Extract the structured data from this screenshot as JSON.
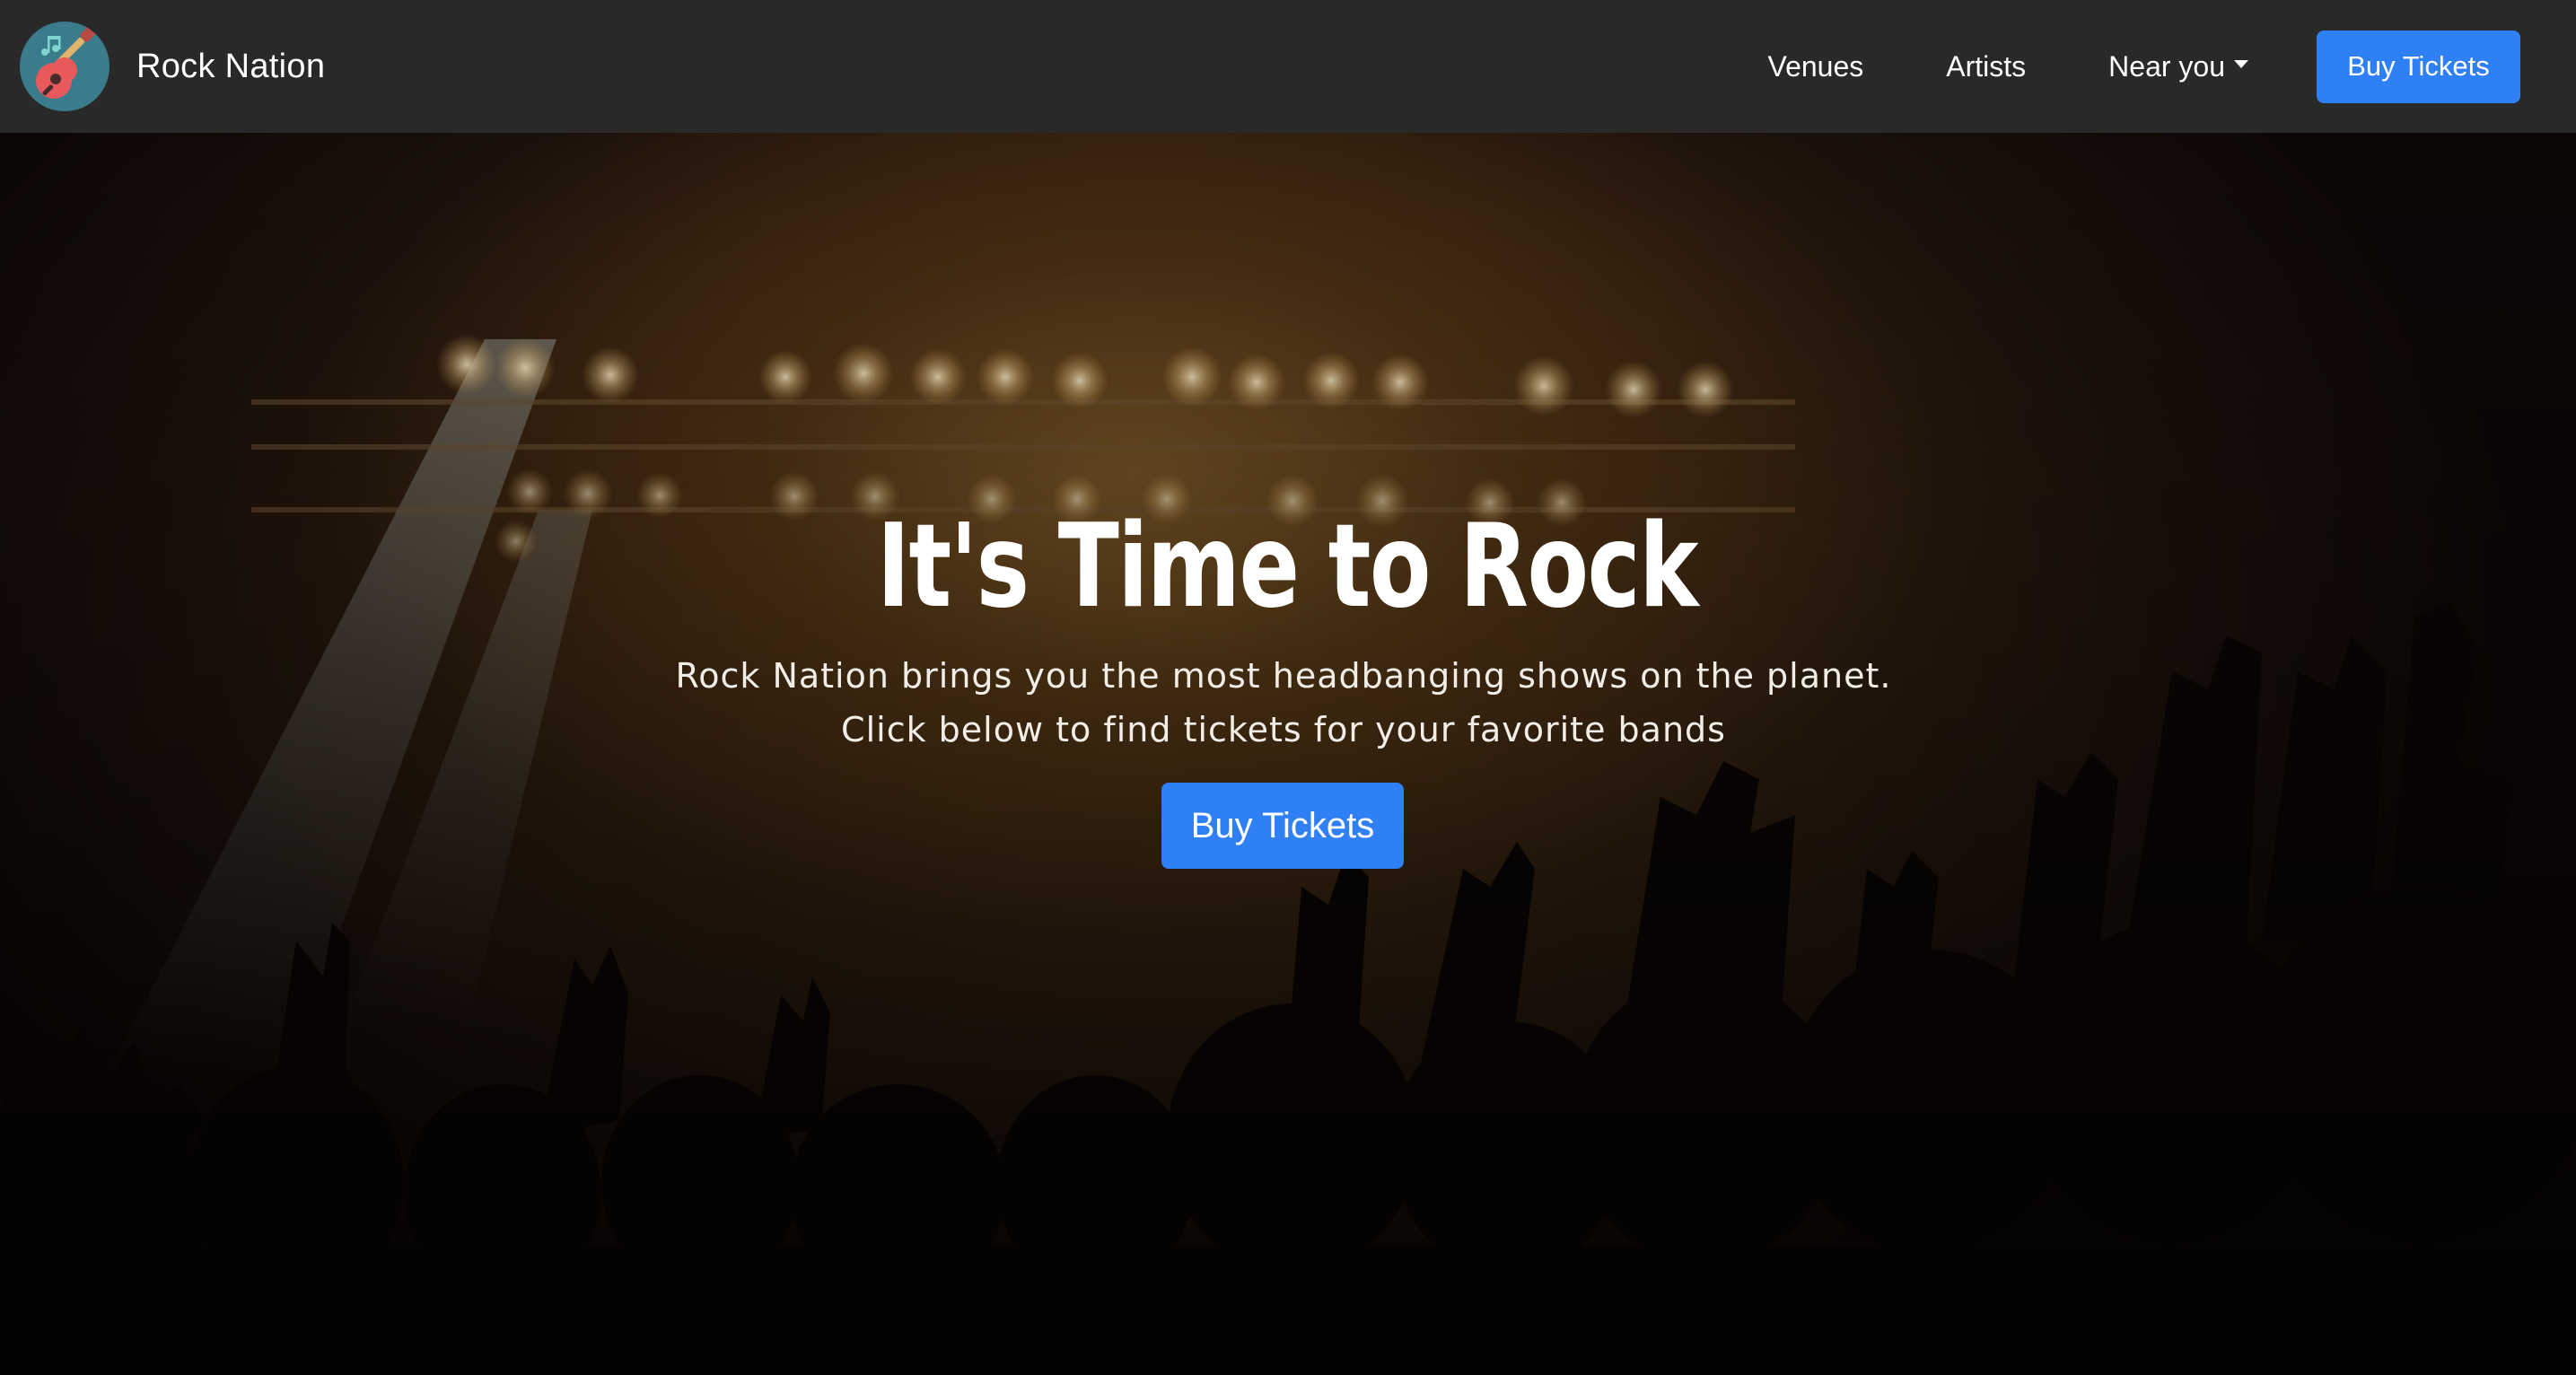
{
  "navbar": {
    "brand_name": "Rock Nation",
    "logo_icon": "guitar-icon",
    "links": {
      "venues": "Venues",
      "artists": "Artists",
      "near_you": "Near you"
    },
    "buy_label": "Buy Tickets"
  },
  "hero": {
    "title": "It's Time to Rock",
    "subtitle": "Rock Nation brings you the most headbanging shows on the planet. Click below to find tickets for your favorite bands",
    "buy_label": "Buy Tickets"
  },
  "colors": {
    "navbar_bg": "#292929",
    "accent": "#2f7ff5",
    "logo_bg": "#3b7c8c"
  }
}
